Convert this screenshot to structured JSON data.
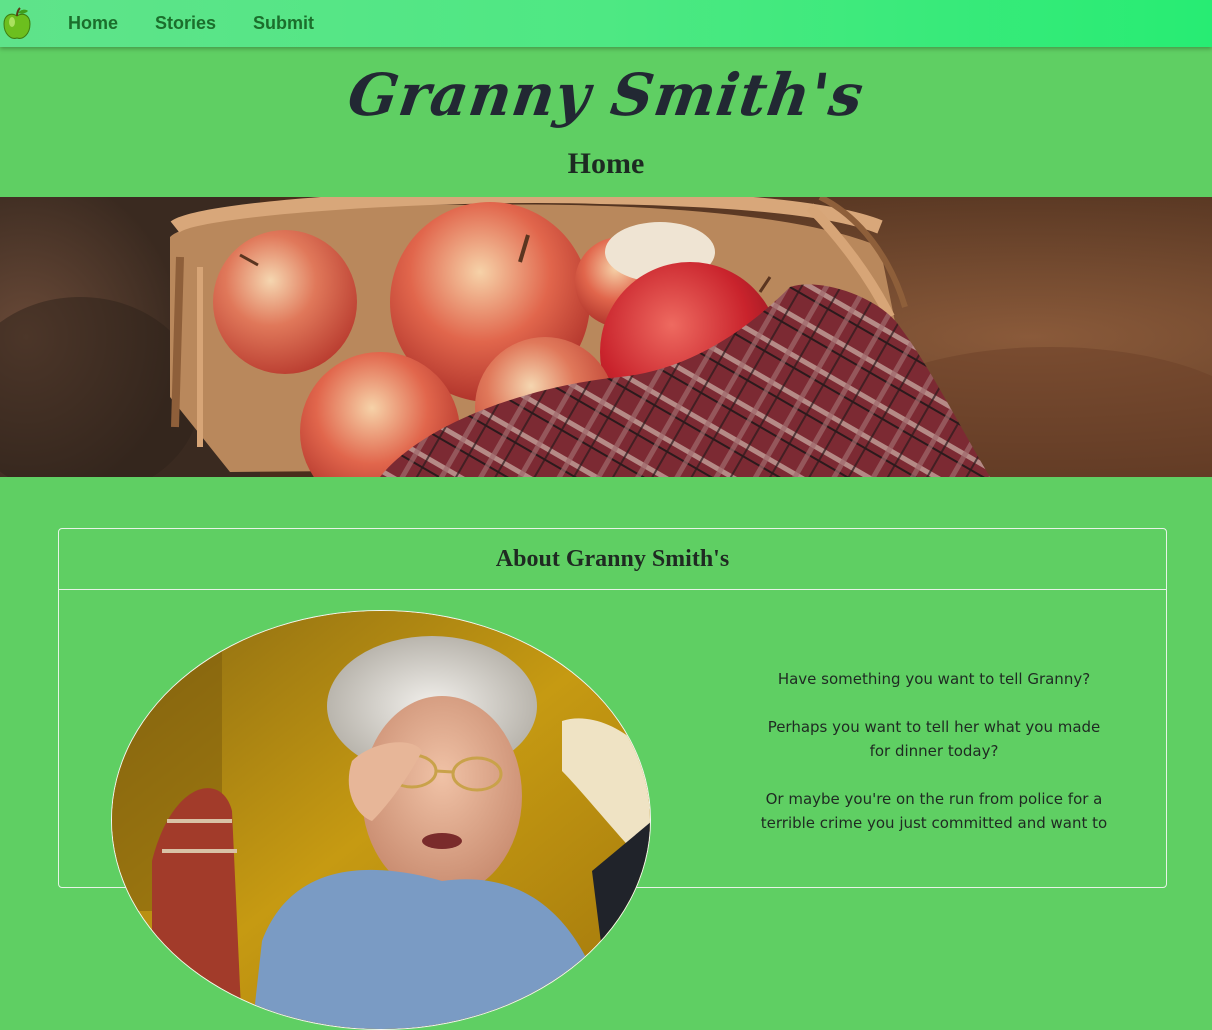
{
  "nav": {
    "logo_icon": "green-apple-icon",
    "items": [
      {
        "label": "Home"
      },
      {
        "label": "Stories"
      },
      {
        "label": "Submit"
      }
    ]
  },
  "header": {
    "brand": "Granny Smith's",
    "page_title": "Home"
  },
  "hero": {
    "image_description": "basket-of-apples-photo"
  },
  "about": {
    "title": "About Granny Smith's",
    "paragraphs": [
      "Have something you want to tell Granny?",
      "Perhaps you want to tell her what you made for dinner today?",
      "Or maybe you're on the run from police for a terrible crime you just committed and want to"
    ]
  },
  "colors": {
    "page_bg": "#5fcf63",
    "nav_text": "#1b6e2c",
    "heading_text": "#1f2a22"
  }
}
